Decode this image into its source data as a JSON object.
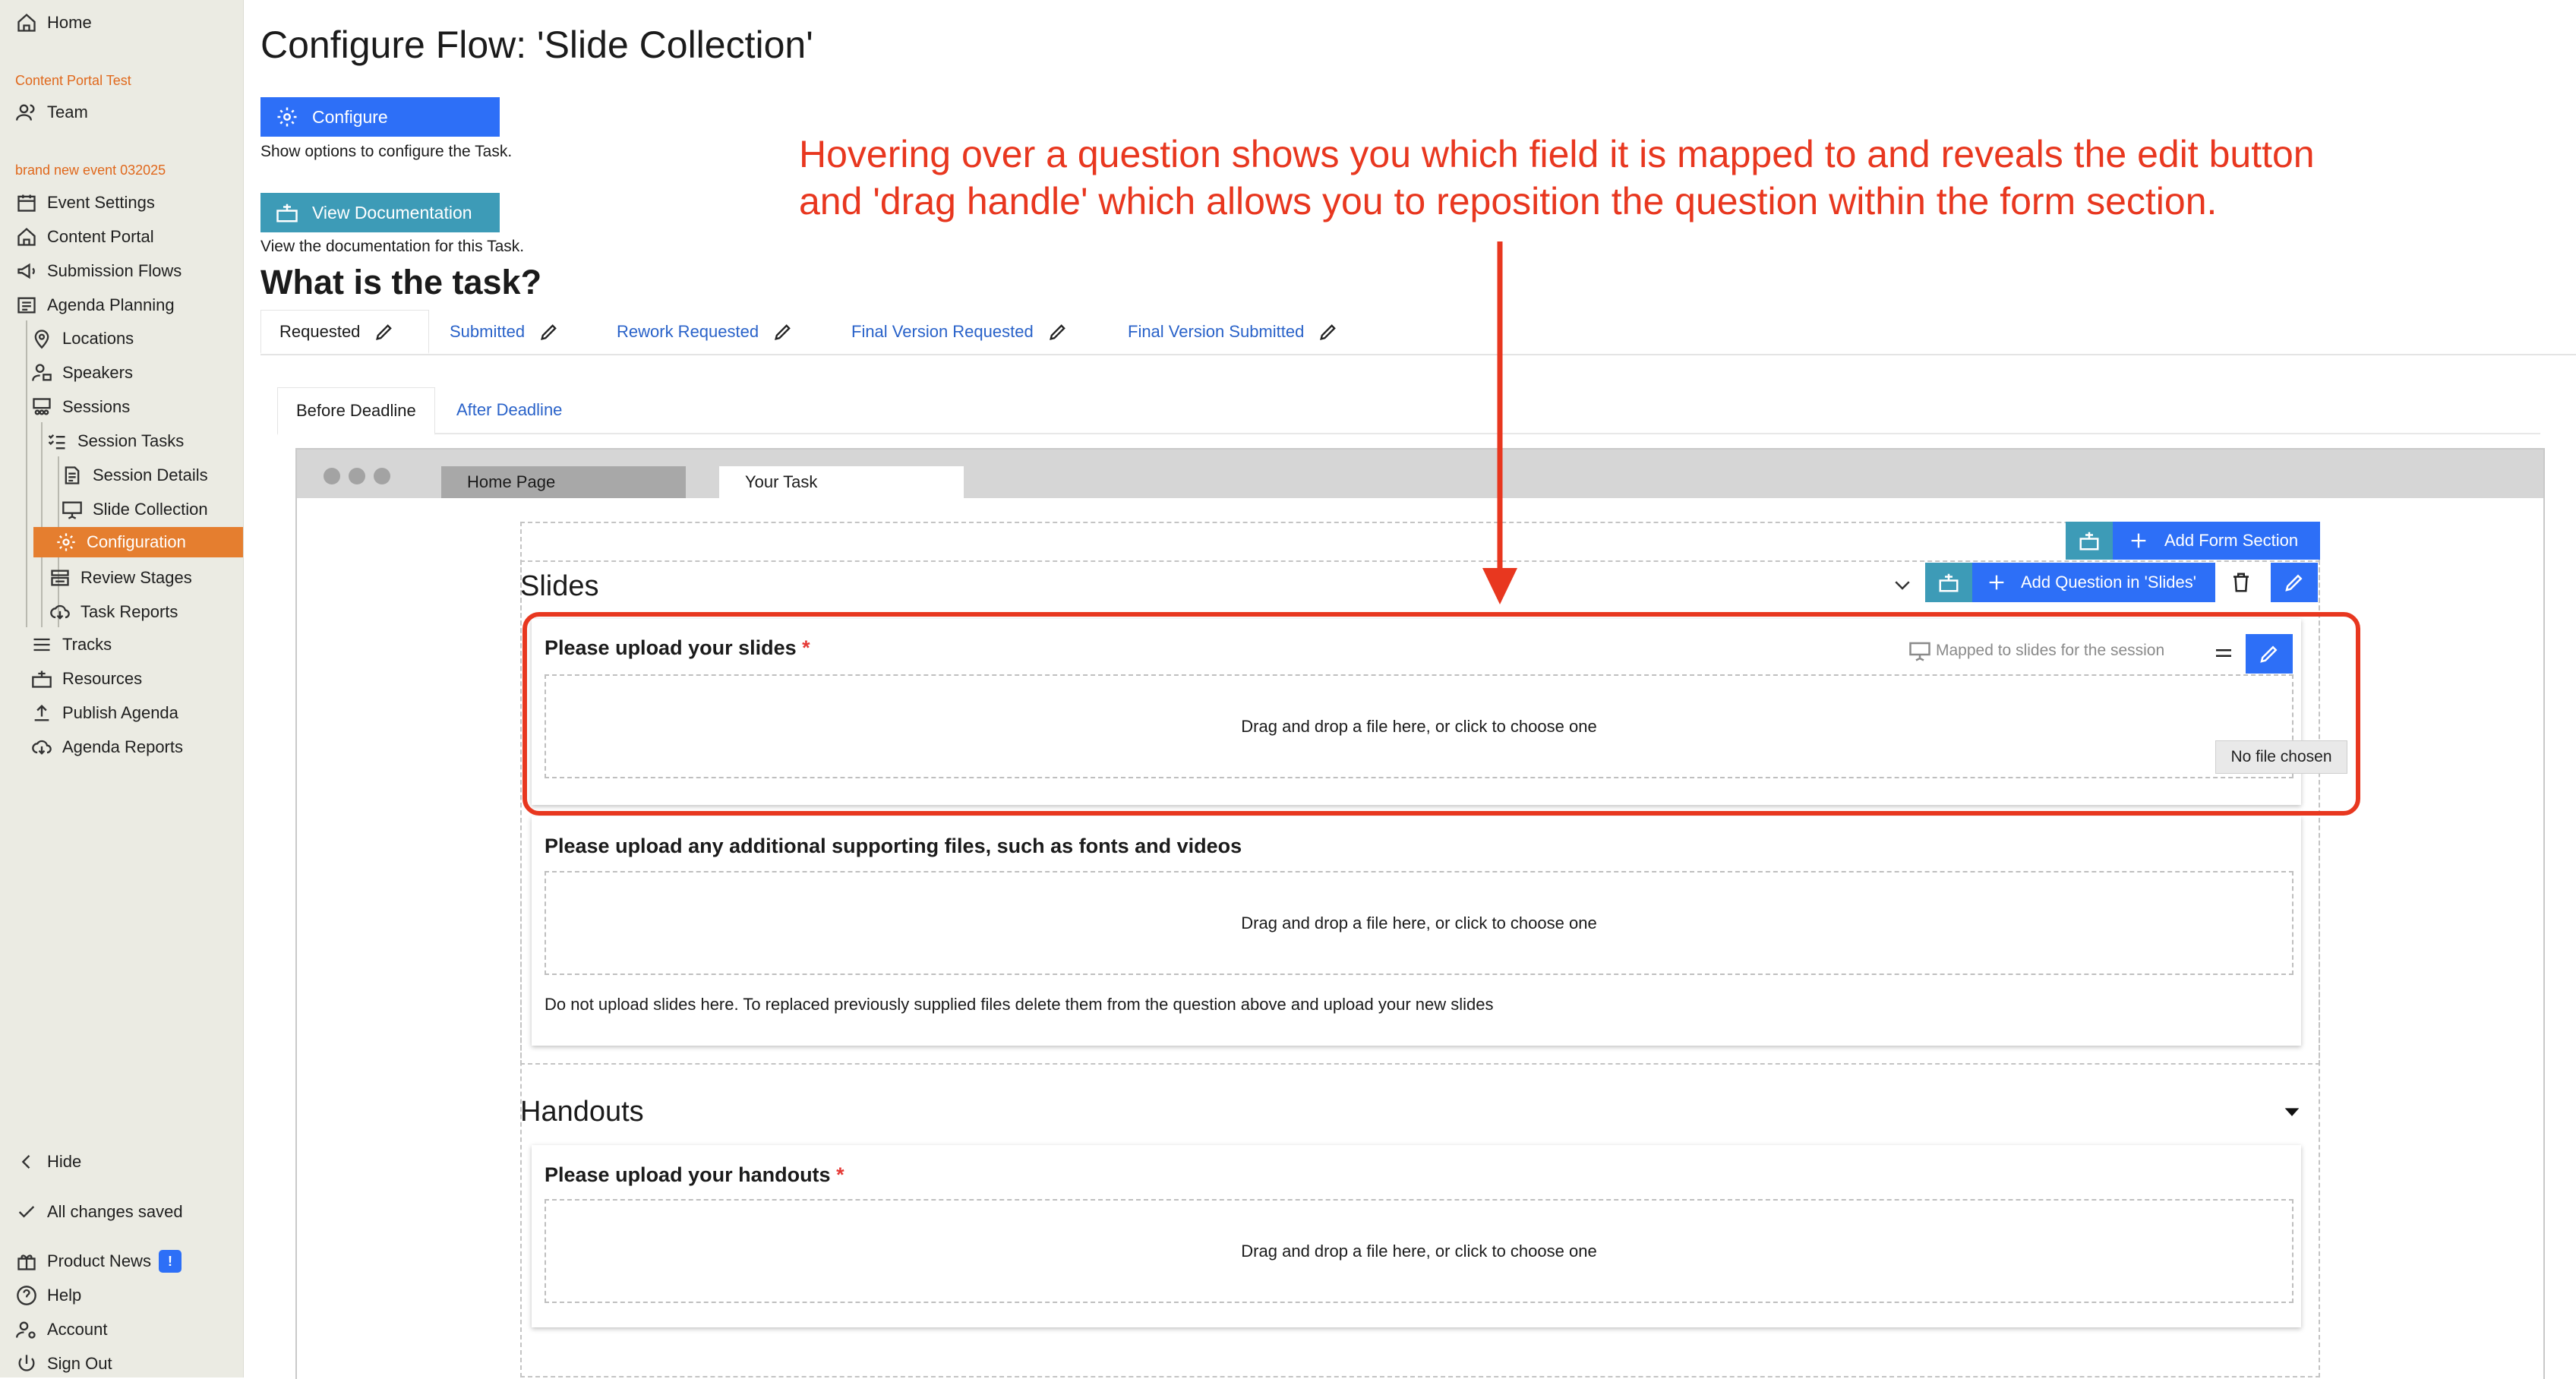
{
  "sidebar": {
    "home": "Home",
    "group_org": "Content Portal Test",
    "team": "Team",
    "group_event": "brand new event 032025",
    "items": [
      {
        "label": "Event Settings"
      },
      {
        "label": "Content Portal"
      },
      {
        "label": "Submission Flows"
      },
      {
        "label": "Agenda Planning"
      },
      {
        "label": "Locations"
      },
      {
        "label": "Speakers"
      },
      {
        "label": "Sessions"
      },
      {
        "label": "Session Tasks"
      },
      {
        "label": "Session Details"
      },
      {
        "label": "Slide Collection"
      },
      {
        "label": "Configuration"
      },
      {
        "label": "Review Stages"
      },
      {
        "label": "Task Reports"
      },
      {
        "label": "Tracks"
      },
      {
        "label": "Resources"
      },
      {
        "label": "Publish Agenda"
      },
      {
        "label": "Agenda Reports"
      }
    ],
    "hide": "Hide",
    "saved_status": "All changes saved",
    "product_news": "Product News",
    "product_news_badge": "!",
    "help": "Help",
    "account": "Account",
    "sign_out": "Sign Out"
  },
  "main": {
    "title": "Configure Flow: 'Slide Collection'",
    "configure_button": "Configure",
    "configure_caption": "Show options to configure the Task.",
    "docs_button": "View Documentation",
    "docs_caption": "View the documentation for this Task.",
    "task_heading": "What is the task?",
    "tabs": [
      {
        "label": "Requested"
      },
      {
        "label": "Submitted"
      },
      {
        "label": "Rework Requested"
      },
      {
        "label": "Final Version Requested"
      },
      {
        "label": "Final Version Submitted"
      }
    ],
    "subtabs": [
      {
        "label": "Before Deadline"
      },
      {
        "label": "After Deadline"
      }
    ]
  },
  "browser": {
    "tabs": [
      {
        "label": "Home Page"
      },
      {
        "label": "Your Task"
      }
    ]
  },
  "form": {
    "add_form_section": "Add Form Section",
    "sections": [
      {
        "title": "Slides",
        "add_question": "Add Question in 'Slides'",
        "questions": [
          {
            "label": "Please upload your slides",
            "required": "*",
            "mapping": "Mapped to slides for the session",
            "dropzone": "Drag and drop a file here, or click to choose one",
            "tooltip": "No file chosen"
          },
          {
            "label": "Please upload any additional supporting files, such as fonts and videos",
            "dropzone": "Drag and drop a file here, or click to choose one",
            "help": "Do not upload slides here. To replaced previously supplied files delete them from the question above and upload your new slides"
          }
        ]
      },
      {
        "title": "Handouts",
        "questions": [
          {
            "label": "Please upload your handouts",
            "required": "*",
            "dropzone": "Drag and drop a file here, or click to choose one"
          }
        ]
      }
    ]
  },
  "annotation": {
    "line1": "Hovering over a question shows you which field it is mapped to and reveals the edit button",
    "line2": "and 'drag handle' which allows you to reposition the question within the form section."
  },
  "colors": {
    "accent_orange": "#e57e2f",
    "primary_blue": "#2d6ff7",
    "teal": "#3d9bb7",
    "annotation_red": "#e8371f"
  }
}
